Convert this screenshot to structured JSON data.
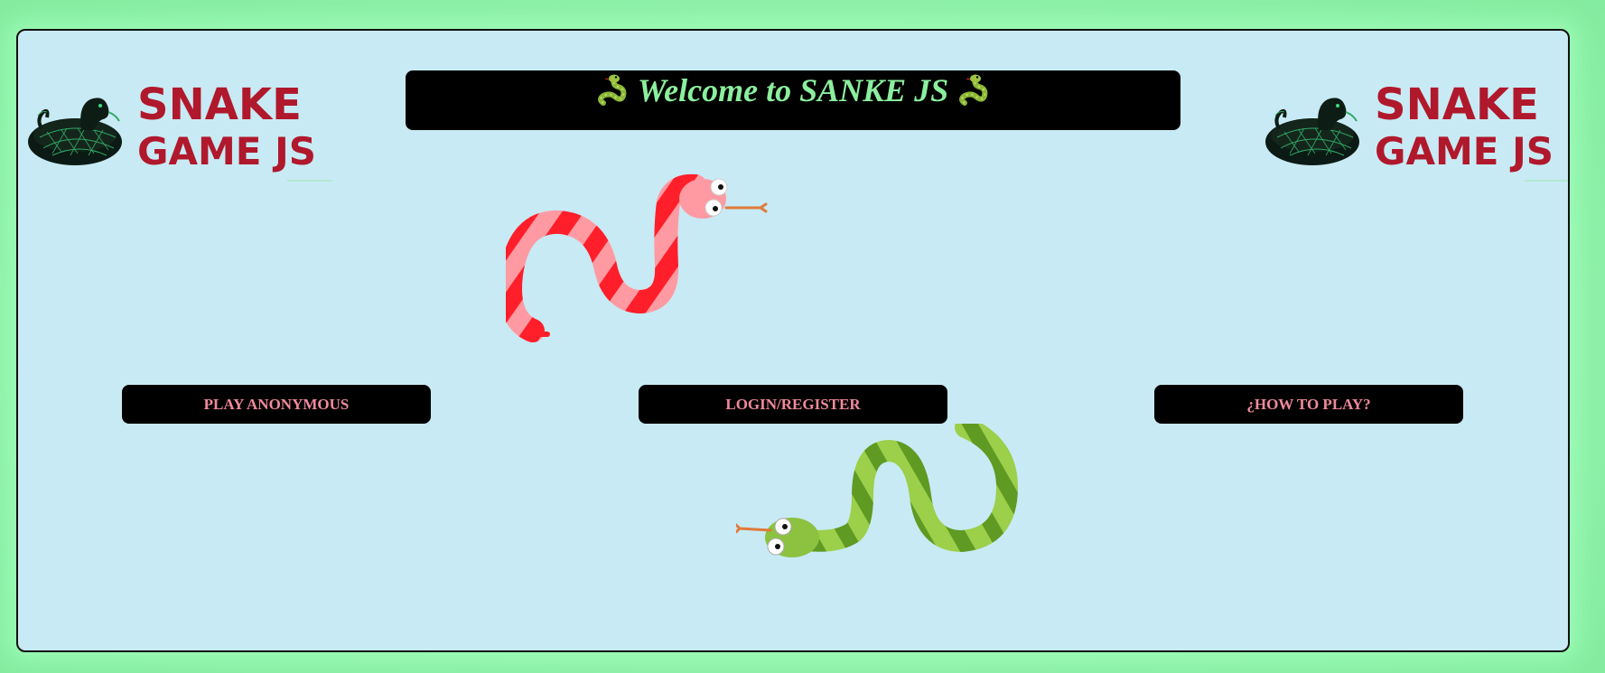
{
  "header": {
    "title": "Welcome to SANKE JS",
    "title_color": "#8bef9d",
    "banner_bg": "#000000"
  },
  "logo": {
    "line1": "SNAKE",
    "line2": "GAME JS",
    "color": "#b0182c",
    "icon": "coiled-snake-icon"
  },
  "menu": {
    "play_anonymous": "PLAY ANONYMOUS",
    "login_register": "LOGIN/REGISTER",
    "how_to_play": "¿HOW TO PLAY?",
    "label_color": "#f08a9a",
    "button_bg": "#000000"
  },
  "decorations": {
    "top_snake": "red-striped-snake",
    "bottom_snake": "green-striped-snake"
  },
  "colors": {
    "page_bg": "#8ef0a8",
    "panel_bg": "#c8eaf4"
  }
}
